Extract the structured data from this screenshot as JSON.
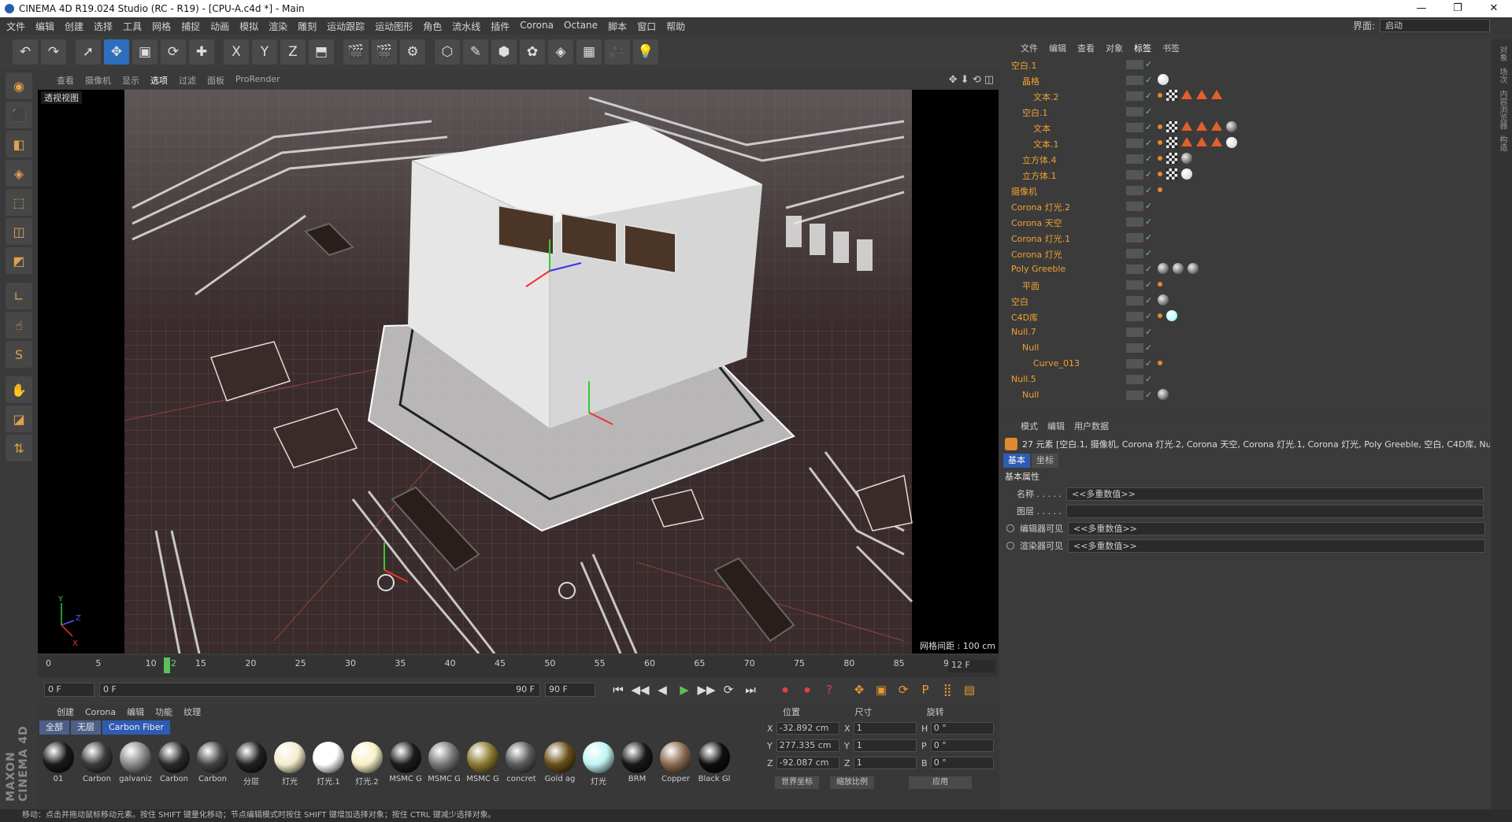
{
  "window": {
    "title": "CINEMA 4D R19.024 Studio (RC - R19) - [CPU-A.c4d *] - Main",
    "minimize": "—",
    "maximize": "❐",
    "close": "✕"
  },
  "menu": {
    "items": [
      "文件",
      "编辑",
      "创建",
      "选择",
      "工具",
      "网格",
      "捕捉",
      "动画",
      "模拟",
      "渲染",
      "雕刻",
      "运动跟踪",
      "运动图形",
      "角色",
      "流水线",
      "插件",
      "Corona",
      "Octane",
      "脚本",
      "窗口",
      "帮助"
    ],
    "interface_label": "界面:",
    "interface_value": "启动"
  },
  "toolbar": {
    "icons": [
      "undo-icon",
      "redo-icon",
      "select-icon",
      "move-icon",
      "scale-icon",
      "rotate-icon",
      "add-icon",
      "x-axis-icon",
      "y-axis-icon",
      "z-axis-icon",
      "coordinate-icon",
      "render-view-icon",
      "render-picture-icon",
      "render-settings-icon",
      "cube-icon",
      "pen-icon",
      "subdivide-icon",
      "cloner-icon",
      "deformer-icon",
      "floor-icon",
      "camera-icon",
      "light-icon"
    ],
    "glyphs": [
      "↶",
      "↷",
      "➚",
      "✥",
      "▣",
      "⟳",
      "✚",
      "X",
      "Y",
      "Z",
      "⬒",
      "🎬",
      "🎬",
      "⚙",
      "⬡",
      "✎",
      "⬢",
      "✿",
      "◈",
      "▦",
      "🎥",
      "💡"
    ]
  },
  "lefttools": [
    "◉",
    "⬛",
    "◧",
    "◈",
    "⬚",
    "◫",
    "◩",
    "∟",
    "☝",
    "S",
    "✋",
    "◪",
    "⇅"
  ],
  "brand": "MAXON CINEMA 4D",
  "viewport_menu": {
    "items": [
      "查看",
      "摄像机",
      "显示",
      "选项",
      "过滤",
      "面板",
      "ProRender"
    ],
    "active": "选项",
    "nav": "✥ ⬇ ⟲ ◫"
  },
  "viewport": {
    "label": "透视视图",
    "grid_label": "网格间距 : 100 cm",
    "axes": {
      "x": "X",
      "y": "Y",
      "z": "Z"
    }
  },
  "timeline": {
    "ticks": [
      "0",
      "5",
      "10",
      "12",
      "15",
      "20",
      "25",
      "30",
      "35",
      "40",
      "45",
      "50",
      "55",
      "60",
      "65",
      "70",
      "75",
      "80",
      "85",
      "90"
    ],
    "fps": "12 F"
  },
  "playbar": {
    "start": "0 F",
    "current": "0 F",
    "end_slider": "90 F",
    "end": "90 F",
    "buttons": [
      "⏮",
      "◀◀",
      "◀",
      "▶",
      "▶▶",
      "⟳",
      "⏭"
    ],
    "rec_buttons": [
      "⏺",
      "⏺",
      "?"
    ],
    "key_buttons": [
      "✥",
      "▣",
      "⟳",
      "P",
      "⣿",
      "▤"
    ]
  },
  "materials": {
    "tabs": [
      "创建",
      "Corona",
      "编辑",
      "功能",
      "纹理"
    ],
    "filters": [
      "全部",
      "无层",
      "Carbon Fiber"
    ],
    "selected_filter": "Carbon Fiber",
    "items": [
      {
        "label": "01",
        "color": "#1a1a1a"
      },
      {
        "label": "Carbon",
        "color": "#3a3a3a"
      },
      {
        "label": "galvaniz",
        "color": "#8a8a8a"
      },
      {
        "label": "Carbon",
        "color": "#2a2a2a"
      },
      {
        "label": "Carbon",
        "color": "#444"
      },
      {
        "label": "分层",
        "color": "#222"
      },
      {
        "label": "灯光",
        "color": "#f4eccc"
      },
      {
        "label": "灯光.1",
        "color": "#ffffff"
      },
      {
        "label": "灯光.2",
        "color": "#f8f0c8"
      },
      {
        "label": "MSMC G",
        "color": "#1c1c1c"
      },
      {
        "label": "MSMC G",
        "color": "#777"
      },
      {
        "label": "MSMC G",
        "color": "#8a7a30"
      },
      {
        "label": "concret",
        "color": "#5a5a5a"
      },
      {
        "label": "Gold ag",
        "color": "#6a5018"
      },
      {
        "label": "灯光",
        "color": "#bff4f4"
      },
      {
        "label": "BRM",
        "color": "#181818"
      },
      {
        "label": "Copper",
        "color": "#8a6a50"
      },
      {
        "label": "Black Gl",
        "color": "#0e0e0e"
      }
    ]
  },
  "coords": {
    "headers": [
      "位置",
      "尺寸",
      "旋转"
    ],
    "rows": [
      {
        "pos_axis": "X",
        "pos": "-32.892 cm",
        "size_axis": "X",
        "size": "1",
        "rot_axis": "H",
        "rot": "0 °"
      },
      {
        "pos_axis": "Y",
        "pos": "277.335 cm",
        "size_axis": "Y",
        "size": "1",
        "rot_axis": "P",
        "rot": "0 °"
      },
      {
        "pos_axis": "Z",
        "pos": "-92.087 cm",
        "size_axis": "Z",
        "size": "1",
        "rot_axis": "B",
        "rot": "0 °"
      }
    ],
    "mode_world": "世界坐标",
    "mode_scale": "缩放比例",
    "apply": "应用"
  },
  "status": "移动：点击并拖动鼠标移动元素。按住 SHIFT 键量化移动；节点编辑模式时按住 SHIFT 键增加选择对象；按住 CTRL 键减少选择对象。",
  "object_manager": {
    "tabs": [
      "文件",
      "编辑",
      "查看",
      "对象",
      "标签",
      "书签"
    ],
    "active_tab": "标签",
    "rows": [
      {
        "name": "空白.1",
        "indent": 0,
        "hi": true,
        "tags": []
      },
      {
        "name": "晶格",
        "indent": 1,
        "hi": true,
        "tags": [
          "sph w"
        ]
      },
      {
        "name": "文本.2",
        "indent": 2,
        "hi": true,
        "tags": [
          "odot",
          "chkr",
          "tri",
          "tri",
          "tri"
        ]
      },
      {
        "name": "空白.1",
        "indent": 1,
        "hi": true,
        "tags": []
      },
      {
        "name": "文本",
        "indent": 2,
        "hi": true,
        "tags": [
          "odot",
          "chkr",
          "tri",
          "tri",
          "tri",
          "sph"
        ]
      },
      {
        "name": "文本.1",
        "indent": 2,
        "hi": true,
        "tags": [
          "odot",
          "chkr",
          "tri",
          "tri",
          "tri",
          "sph w"
        ]
      },
      {
        "name": "立方体.4",
        "indent": 1,
        "hi": true,
        "tags": [
          "odot",
          "chkr",
          "sph"
        ]
      },
      {
        "name": "立方体.1",
        "indent": 1,
        "hi": true,
        "tags": [
          "odot",
          "chkr",
          "sph w"
        ]
      },
      {
        "name": "摄像机",
        "indent": 0,
        "hi": true,
        "tags": [
          "odot"
        ]
      },
      {
        "name": "Corona 灯光.2",
        "indent": 0,
        "hi": true,
        "tags": []
      },
      {
        "name": "Corona 天空",
        "indent": 0,
        "hi": true,
        "tags": []
      },
      {
        "name": "Corona 灯光.1",
        "indent": 0,
        "hi": true,
        "tags": []
      },
      {
        "name": "Corona 灯光",
        "indent": 0,
        "hi": true,
        "tags": []
      },
      {
        "name": "Poly Greeble",
        "indent": 0,
        "hi": true,
        "tags": [
          "sph",
          "sph",
          "sph"
        ]
      },
      {
        "name": "平面",
        "indent": 1,
        "hi": true,
        "tags": [
          "odot"
        ]
      },
      {
        "name": "空白",
        "indent": 0,
        "hi": true,
        "tags": [
          "sph"
        ]
      },
      {
        "name": "C4D库",
        "indent": 0,
        "hi": true,
        "tags": [
          "odot",
          "sph cy"
        ]
      },
      {
        "name": "Null.7",
        "indent": 0,
        "hi": true,
        "tags": []
      },
      {
        "name": "Null",
        "indent": 1,
        "hi": true,
        "tags": []
      },
      {
        "name": "Curve_013",
        "indent": 2,
        "hi": true,
        "tags": [
          "odot"
        ]
      },
      {
        "name": "Null.5",
        "indent": 0,
        "hi": true,
        "tags": []
      },
      {
        "name": "Null",
        "indent": 1,
        "hi": true,
        "tags": [
          "sph"
        ]
      }
    ]
  },
  "attribute_manager": {
    "tabs": [
      "模式",
      "编辑",
      "用户数据"
    ],
    "selection": "27 元素 [空白.1, 摄像机, Corona 灯光.2, Corona 天空, Corona 灯光.1, Corona 灯光, Poly Greeble, 空白, C4D库, Null.7, N",
    "subtabs": [
      "基本",
      "坐标"
    ],
    "section": "基本属性",
    "fields": [
      {
        "label": "名称 . . . . .",
        "value": "<<多重数值>>"
      },
      {
        "label": "图层 . . . . .",
        "value": ""
      },
      {
        "label": "编辑器可见",
        "value": "<<多重数值>>"
      },
      {
        "label": "渲染器可见",
        "value": "<<多重数值>>"
      }
    ]
  },
  "right_strip": [
    "对象",
    "场次",
    "内容浏览器",
    "构造"
  ]
}
